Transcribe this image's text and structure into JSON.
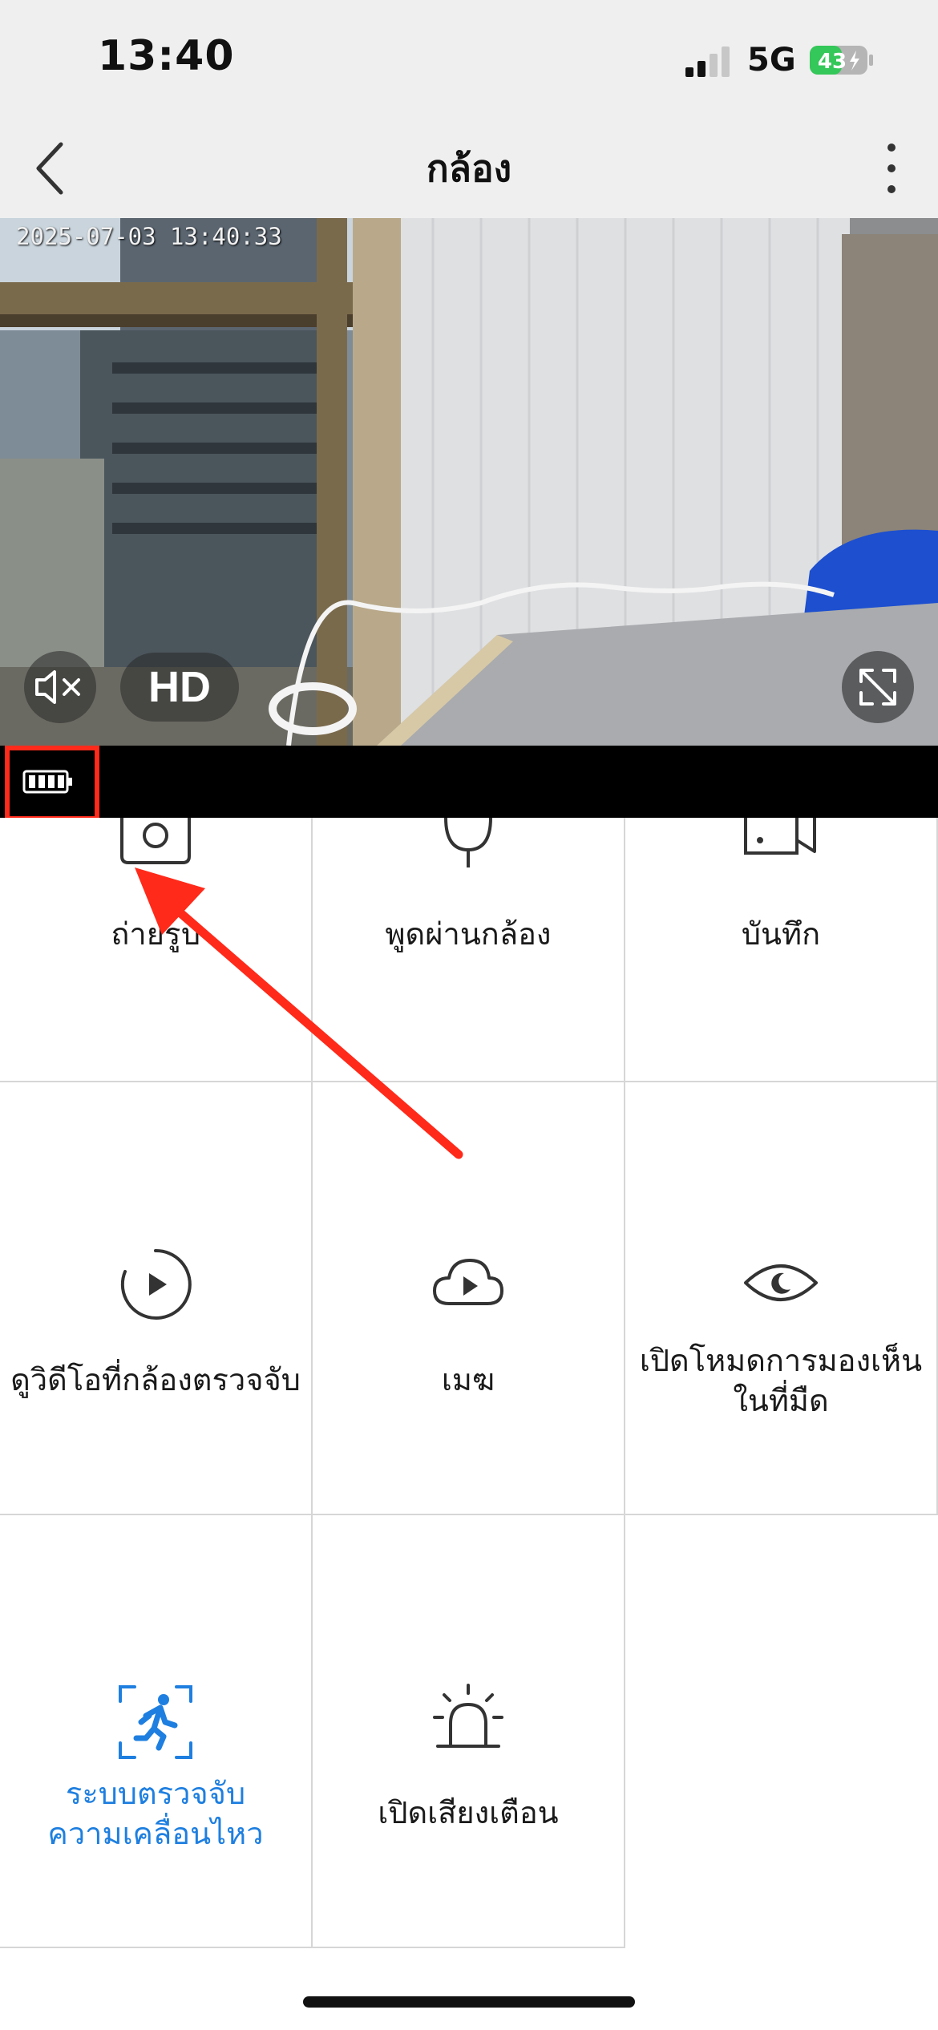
{
  "status_bar": {
    "time": "13:40",
    "network": "5G",
    "battery_level": "43"
  },
  "nav": {
    "title": "กล้อง"
  },
  "camera": {
    "timestamp": "2025-07-03 13:40:33",
    "quality_label": "HD"
  },
  "grid": {
    "snapshot_label": "ถ่ายรูป",
    "talk_label": "พูดผ่านกล้อง",
    "record_label": "บันทึก",
    "detection_videos_label": "ดูวิดีโอที่กล้องตรวจจับ",
    "cloud_label": "เมฆ",
    "night_vision_label": [
      "เปิดโหมดการมองเห็น",
      "ในที่มืด"
    ],
    "motion_detection_label": [
      "ระบบตรวจจับ",
      "ความเคลื่อนไหว"
    ],
    "alarm_label": "เปิดเสียงเตือน"
  },
  "colors": {
    "accent_blue": "#1e7fe0",
    "annotation_red": "#ff2a1a",
    "battery_green": "#34c759"
  }
}
